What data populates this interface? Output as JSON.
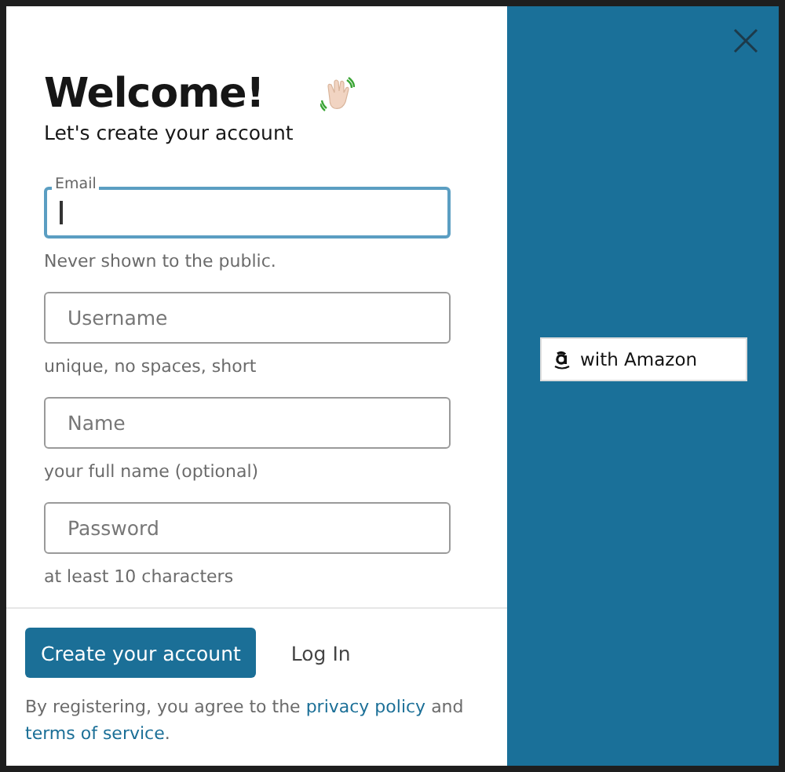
{
  "dialog": {
    "title": "Welcome!",
    "subtitle": "Let's create your account"
  },
  "fields": [
    {
      "label": "Email",
      "focused": true,
      "helper": "Never shown to the public."
    },
    {
      "placeholder": "Username",
      "focused": false,
      "helper": "unique, no spaces, short"
    },
    {
      "placeholder": "Name",
      "focused": false,
      "helper": "your full name (optional)"
    },
    {
      "placeholder": "Password",
      "focused": false,
      "helper": "at least 10 characters"
    }
  ],
  "actions": {
    "primary": "Create your account",
    "secondary": "Log In"
  },
  "legal": [
    {
      "kind": "text",
      "text": "By registering, you agree to the"
    },
    {
      "kind": "link",
      "text": "privacy policy"
    },
    {
      "kind": "text",
      "text": "and"
    },
    {
      "kind": "link",
      "text": "terms of service"
    },
    {
      "kind": "text",
      "text": "."
    }
  ],
  "side": {
    "provider_button": "with Amazon"
  }
}
